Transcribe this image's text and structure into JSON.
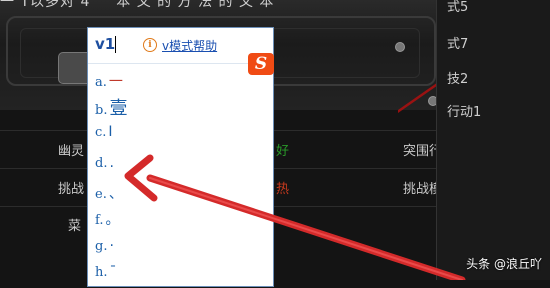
{
  "background": {
    "title_fragment": "一 T以多对 4 　 本 文 的 方 法 的 文 本",
    "rows": [
      {
        "left": "幽灵",
        "mid": "好",
        "right": "突围行动1"
      },
      {
        "left": "挑战",
        "mid": "热",
        "right": "挑战模式2"
      },
      {
        "left": "菜",
        "mid": "",
        "right": ""
      }
    ],
    "right_menu": [
      "式5",
      "式7",
      "技2",
      "行动1"
    ]
  },
  "ime": {
    "composition": "v1",
    "help_link": "v模式帮助",
    "logo_letter": "S",
    "candidates": [
      {
        "key": "a.",
        "glyph": "一"
      },
      {
        "key": "b.",
        "glyph": "壹"
      },
      {
        "key": "c.",
        "glyph": "Ⅰ"
      },
      {
        "key": "d.",
        "glyph": "."
      },
      {
        "key": "e.",
        "glyph": "、"
      },
      {
        "key": "f.",
        "glyph": "。"
      },
      {
        "key": "g.",
        "glyph": "·"
      },
      {
        "key": "h.",
        "glyph": "¯"
      }
    ]
  },
  "watermark": "头条 @浪丘吖",
  "colors": {
    "arrow": "#d42a2a",
    "ime_text": "#1b5fa8",
    "logo": "#f04b14"
  }
}
